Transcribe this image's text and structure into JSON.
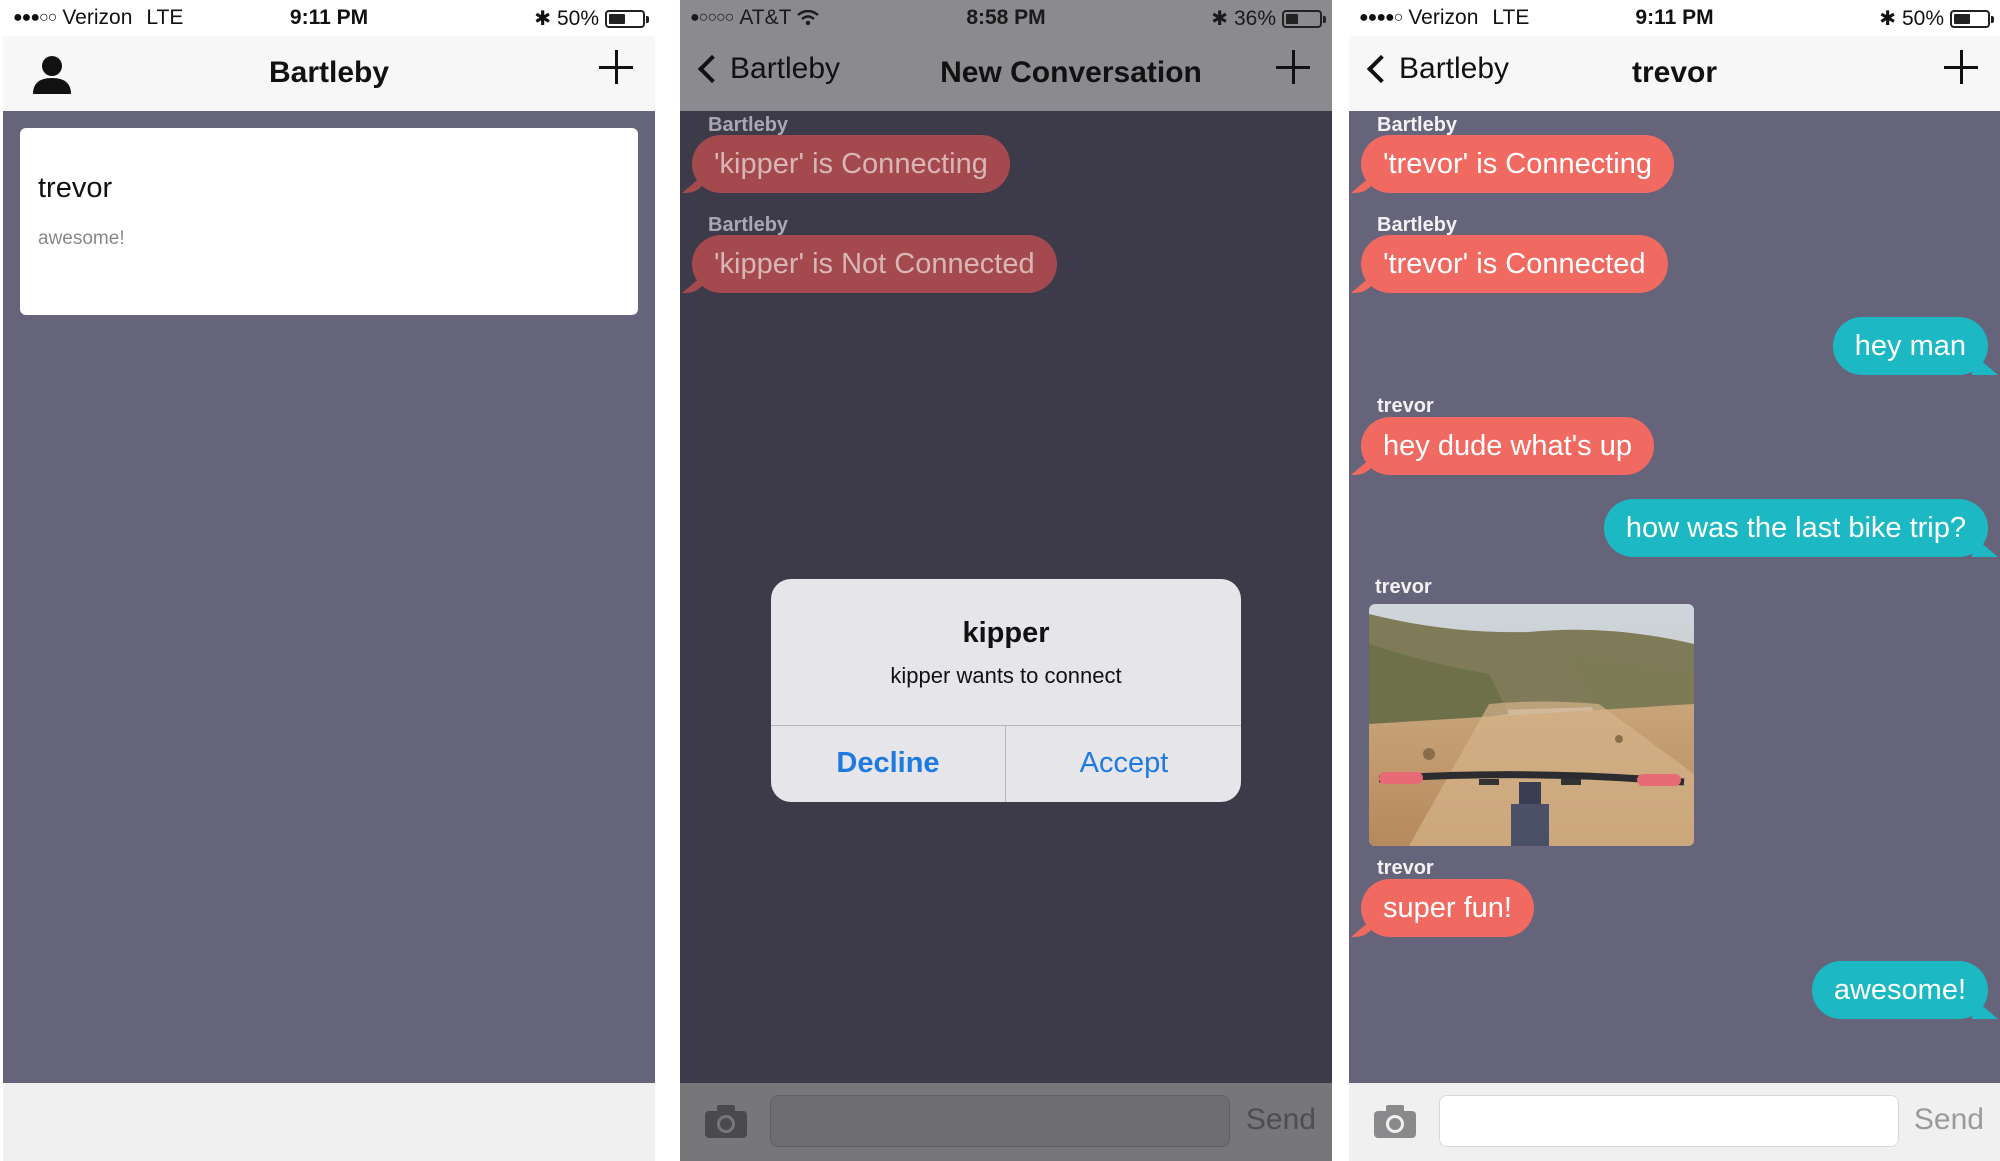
{
  "phone1": {
    "status": {
      "carrier": "Verizon",
      "network": "LTE",
      "time": "9:11 PM",
      "battery": "50%",
      "battery_level": 0.5
    },
    "nav": {
      "title": "Bartleby"
    },
    "conversation": {
      "name": "trevor",
      "preview": "awesome!"
    }
  },
  "phone2": {
    "status": {
      "carrier": "AT&T",
      "time": "8:58 PM",
      "battery": "36%",
      "battery_level": 0.36
    },
    "nav": {
      "back": "Bartleby",
      "title": "New Conversation"
    },
    "messages": [
      {
        "sender": "Bartleby",
        "text": "'kipper' is Connecting"
      },
      {
        "sender": "Bartleby",
        "text": "'kipper' is Not Connected"
      }
    ],
    "alert": {
      "title": "kipper",
      "message": "kipper wants to connect",
      "decline": "Decline",
      "accept": "Accept"
    },
    "composer": {
      "send": "Send"
    }
  },
  "phone3": {
    "status": {
      "carrier": "Verizon",
      "network": "LTE",
      "time": "9:11 PM",
      "battery": "50%",
      "battery_level": 0.5
    },
    "nav": {
      "back": "Bartleby",
      "title": "trevor"
    },
    "messages": [
      {
        "sender": "Bartleby",
        "text": "'trevor' is Connecting"
      },
      {
        "sender": "Bartleby",
        "text": "'trevor' is Connected"
      },
      {
        "text": "hey man"
      },
      {
        "sender": "trevor",
        "text": "hey dude what's up"
      },
      {
        "text": "how was the last bike trip?"
      },
      {
        "sender": "trevor"
      },
      {
        "sender": "trevor",
        "text": "super fun!"
      },
      {
        "text": "awesome!"
      }
    ],
    "composer": {
      "send": "Send"
    }
  },
  "colors": {
    "incoming": "#f16a61",
    "outgoing": "#1cb8c4",
    "chat_bg": "#65647a",
    "link_blue": "#1f7ae0"
  },
  "icons": [
    "person-icon",
    "plus-icon",
    "back-chevron-icon",
    "camera-icon",
    "bluetooth-icon",
    "wifi-icon",
    "battery-icon",
    "signal-icon"
  ]
}
